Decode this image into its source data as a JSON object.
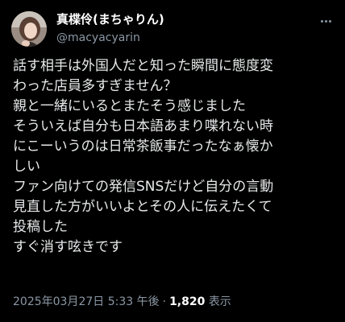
{
  "author": {
    "display_name": "真楪伶(まちゃりん)",
    "handle": "@macyacyarin",
    "avatar_icon": "profile-photo-icon"
  },
  "post": {
    "lines": [
      "話す相手は外国人だと知った瞬間に態度変",
      "わった店員多すぎません？",
      "親と一緒にいるとまたそう感じました",
      "そういえば自分も日本語あまり喋れない時",
      "にこーいうのは日常茶飯事だったなぁ懐か",
      "しい",
      "ファン向けての発信SNSだけど自分の言動",
      "見直した方がいいよとその人に伝えたくて",
      "投稿した",
      "すぐ消す呟きです"
    ]
  },
  "meta": {
    "timestamp": "2025年03月27日 5:33 午後",
    "separator": "·",
    "views_count": "1,820",
    "views_label": "表示"
  },
  "colors": {
    "background": "#000000",
    "text": "#e7e9ea",
    "muted": "#8b98a5"
  }
}
